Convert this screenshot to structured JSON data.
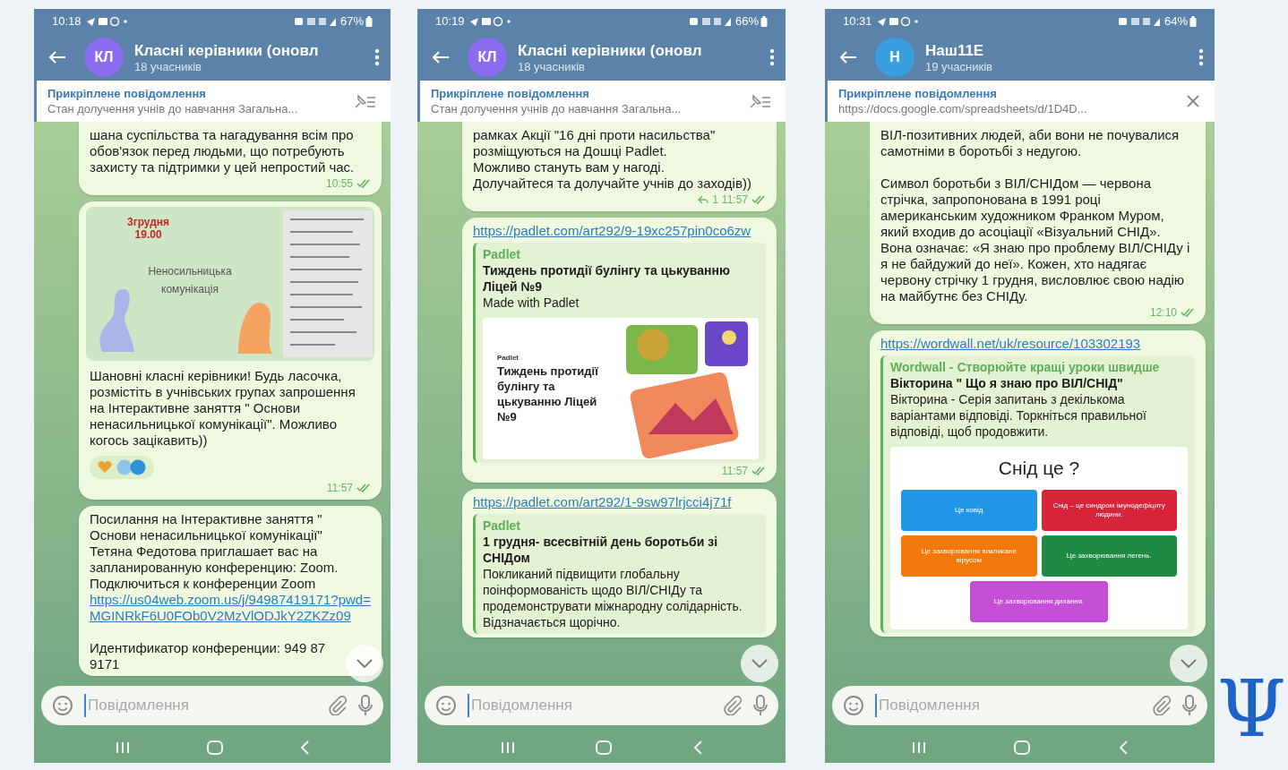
{
  "phones": [
    {
      "status_bar": {
        "time": "10:18",
        "battery": "67%"
      },
      "header": {
        "avatar": {
          "text": "КЛ",
          "color": "#8b6cf0"
        },
        "title": "Класні керівники (оновл",
        "subtitle": "18 учасників"
      },
      "pinned": {
        "label": "Прикріплене повідомлення",
        "text": "Стан долучення учнів до навчання Загальна...",
        "kind": "pins"
      },
      "messages": [
        {
          "blocks": [
            {
              "kind": "text",
              "text": "шана суспільства та нагадування всім про обов'язок перед людьми, що потребують захисту та підтримки у цей непростий час."
            }
          ],
          "time": "10:55",
          "read": true
        },
        {
          "blocks": [
            {
              "kind": "poster",
              "date": "3грудня\n19.00",
              "title": "Неносильницька комунікація"
            },
            {
              "kind": "text",
              "text": "Шановні класні керівники! Будь ласочка, розмістіть в учнівських групах запрошення на Інтерактивне заняття \" Основи ненасильницької комунікації\". Можливо когось зацікавить))"
            },
            {
              "kind": "reactions"
            }
          ],
          "time": "11:57",
          "read": true
        },
        {
          "blocks": [
            {
              "kind": "text",
              "text": "Посилання на Інтерактивне заняття \" Основи ненасильницької комунікації\"\nТетяна Федотова приглашает вас на запланированную конференцию: Zoom.\nПодключиться к конференции Zoom"
            },
            {
              "kind": "link",
              "text": "https://us04web.zoom.us/j/94987419171?pwd=MGINRkF6U0FOb0V2MzVlODJkY2ZKZz09"
            },
            {
              "kind": "text",
              "text": "\nИдентификатор конференции: 949 87\n9171"
            }
          ]
        }
      ],
      "input": {
        "placeholder": "Повідомлення"
      }
    },
    {
      "status_bar": {
        "time": "10:19",
        "battery": "66%"
      },
      "header": {
        "avatar": {
          "text": "КЛ",
          "color": "#8b6cf0"
        },
        "title": "Класні керівники (оновл",
        "subtitle": "18 учасників"
      },
      "pinned": {
        "label": "Прикріплене повідомлення",
        "text": "Стан долучення учнів до навчання Загальна...",
        "kind": "pins"
      },
      "messages": [
        {
          "blocks": [
            {
              "kind": "text",
              "text": "рамках Акції \"16 дні проти насильства\" розміщуються на Дошці Padlet.\nМожливо стануть вам у нагоді.\nДолучайтеся та долучайте учнів до заходів))"
            }
          ],
          "replies": "1",
          "time": "11:57",
          "read": true
        },
        {
          "blocks": [
            {
              "kind": "link",
              "text": "https://padlet.com/art292/9-19xc257pin0co6zw"
            },
            {
              "kind": "preview",
              "site": "Padlet",
              "title": "Тиждень протидії булінгу та цькуванню Ліцей №9",
              "description": "Made with Padlet",
              "image": {
                "kind": "padlet",
                "brand": "Padlet",
                "caption": "Тиждень протидії булінгу та цькуванню Ліцей №9"
              }
            }
          ],
          "time": "11:57",
          "read": true
        },
        {
          "blocks": [
            {
              "kind": "link",
              "text": "https://padlet.com/art292/1-9sw97lrjcci4j71f"
            },
            {
              "kind": "preview",
              "site": "Padlet",
              "title": "1 грудня- всесвітній день боротьби зі СНІДом",
              "description": "Покликаний підвищити глобальну поінформованість щодо ВІЛ/СНІДу та продемонструвати міжнародну солідарність.  Відзначається щорічно."
            }
          ]
        }
      ],
      "input": {
        "placeholder": "Повідомлення"
      }
    },
    {
      "status_bar": {
        "time": "10:31",
        "battery": "64%"
      },
      "header": {
        "avatar": {
          "text": "Н",
          "color": "#3a9fe0"
        },
        "title": "Наш11Е",
        "subtitle": "19 учасників"
      },
      "pinned": {
        "label": "Прикріплене повідомлення",
        "text": "https://docs.google.com/spreadsheets/d/1D4D...",
        "kind": "close"
      },
      "messages": [
        {
          "blocks": [
            {
              "kind": "text",
              "text": "ВІЛ-позитивних людей, аби вони не почувалися самотніми в боротьбі з недугою.\n\nСимвол боротьби з ВІЛ/СНІДом — червона стрічка, запропонована в 1991 році американським художником Франком Муром, який входив до асоціації «Візуальний СНІД». Вона означає: «Я знаю про проблему ВІЛ/СНІДу і я не байдужий до неї». Кожен, хто надягає червону стрічку 1 грудня, висловлює свою надію на майбутнє без СНІДу."
            }
          ],
          "time": "12:10",
          "read": true
        },
        {
          "blocks": [
            {
              "kind": "link",
              "text": "https://wordwall.net/uk/resource/103302193"
            },
            {
              "kind": "preview",
              "site": "Wordwall - Створюйте кращі уроки швидше",
              "title": "Вікторина \" Що я знаю про ВІЛ/СНІД\"",
              "description": "Вікторина - Серія запитань з декількома варіантами відповіді. Торкніться правильної відповіді, щоб продовжити.",
              "image": {
                "kind": "quiz",
                "question": "Снід це ?",
                "answers": [
                  {
                    "text": "Це ковід",
                    "color": "#2196e8"
                  },
                  {
                    "text": "Снід – це синдром імунодефіциту людини.",
                    "color": "#d8243a"
                  },
                  {
                    "text": "Це захворювання викликане вірусом",
                    "color": "#f5780a"
                  },
                  {
                    "text": "Це захворювання легень.",
                    "color": "#1e8a44"
                  },
                  {
                    "text": "Це захворювання дихання.",
                    "color": "#c64fd8"
                  }
                ]
              }
            }
          ]
        }
      ],
      "input": {
        "placeholder": "Повідомлення"
      }
    }
  ],
  "logo": "Ψ"
}
